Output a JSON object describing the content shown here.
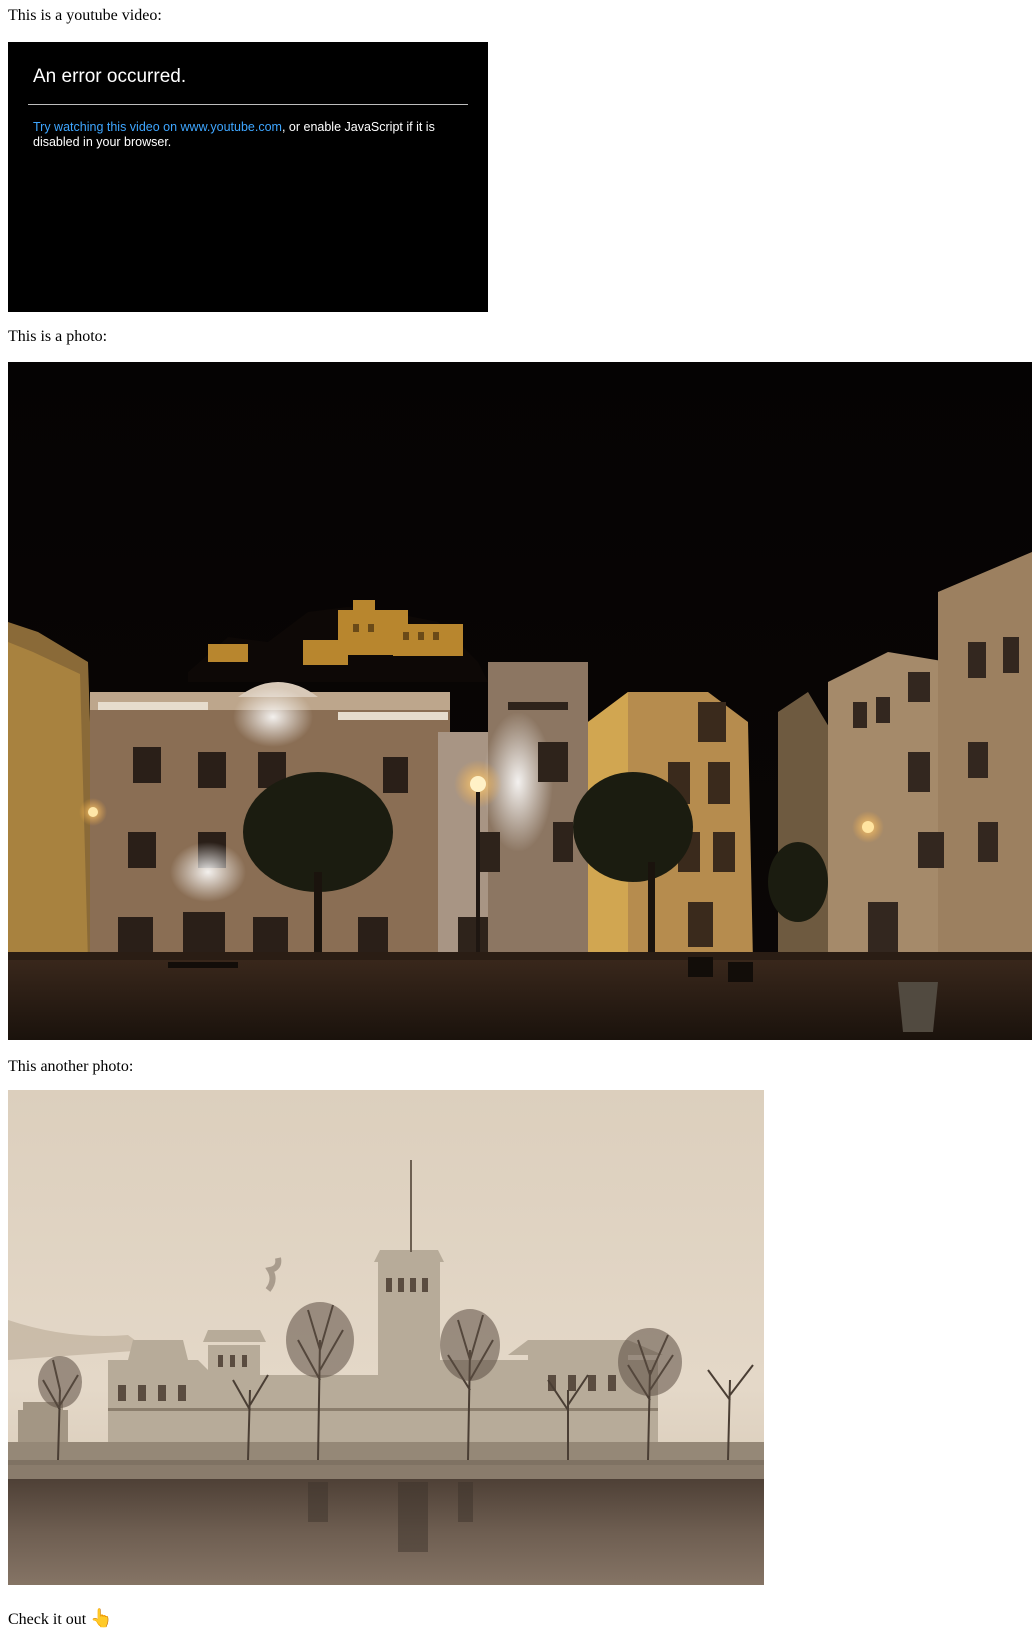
{
  "intro_video_text": "This is a youtube video:",
  "youtube_embed": {
    "error_title": "An error occurred.",
    "link_text": "Try watching this video on www.youtube.com",
    "message_rest": ", or enable JavaScript if it is disabled in your browser."
  },
  "photo_text": "This is a photo:",
  "another_photo_text": "This another photo:",
  "closing_text": "Check it out",
  "closing_emoji": "👆",
  "colors": {
    "link": "#3ea6ff",
    "youtube_bg": "#000000",
    "night_sky": "#050303",
    "sepia_sky": "#dacdbb"
  },
  "icons": [
    "pointing-hand-icon"
  ]
}
